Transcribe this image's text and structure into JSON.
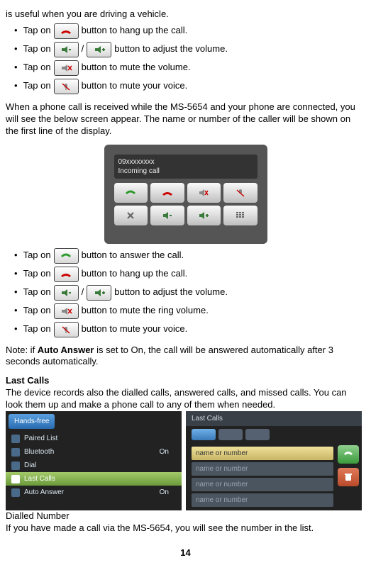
{
  "intro": "is useful when you are driving a vehicle.",
  "sec1": {
    "tap": "Tap on",
    "hangup": " button to hang up the call.",
    "slash": " / ",
    "volume": " button to adjust the volume.",
    "mute_vol": " button to mute the volume.",
    "mute_voice": " button to mute your voice."
  },
  "para_incoming": "When a phone call is received while the MS-5654 and your phone are connected, you will see the below screen appear. The name or number of the caller will be shown on the first line of the display.",
  "incoming_shot": {
    "number": "09xxxxxxxx",
    "label": "Incoming call"
  },
  "sec2": {
    "tap": "Tap on",
    "answer": " button to answer the call.",
    "hangup": " button to hang up the call.",
    "slash": " / ",
    "volume": " button to adjust the volume.",
    "mute_ring": " button to mute the ring volume.",
    "mute_voice": " button to mute your voice."
  },
  "note_prefix": "Note: if ",
  "note_bold": "Auto Answer",
  "note_suffix": " is set to On, the call will be answered automatically after 3 seconds automatically.",
  "lastcalls_head": "Last Calls",
  "lastcalls_para": "The device records also the dialled calls, answered calls, and missed calls. You can look them up and make a phone call to any of them when needed.",
  "menu_shot": {
    "handsfree": "Hands-free",
    "paired": "Paired List",
    "bluetooth": "Bluetooth",
    "dial": "Dial",
    "last": "Last Calls",
    "auto": "Auto Answer",
    "on": "On"
  },
  "lc_shot": {
    "title": "Last Calls",
    "item": "name or number"
  },
  "dialled_head": "Dialled Number",
  "dialled_para": "If you have made a call via the MS-5654, you will see the number in the list.",
  "page": "14"
}
